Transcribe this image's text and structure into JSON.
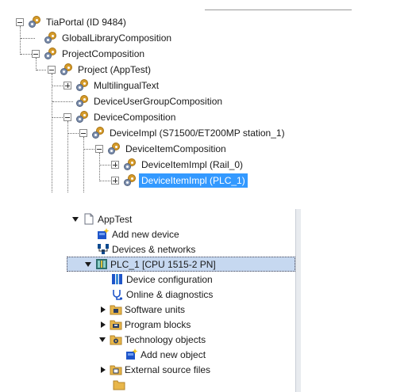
{
  "object_tree": {
    "nodes": [
      {
        "label": "TiaPortal (ID 9484)",
        "expander": "minus"
      },
      {
        "label": "GlobalLibraryComposition",
        "expander": "none"
      },
      {
        "label": "ProjectComposition",
        "expander": "minus"
      },
      {
        "label": "Project (AppTest)",
        "expander": "minus"
      },
      {
        "label": "MultilingualText",
        "expander": "plus"
      },
      {
        "label": "DeviceUserGroupComposition",
        "expander": "none"
      },
      {
        "label": "DeviceComposition",
        "expander": "minus"
      },
      {
        "label": "DeviceImpl (S71500/ET200MP station_1)",
        "expander": "minus"
      },
      {
        "label": "DeviceItemComposition",
        "expander": "minus"
      },
      {
        "label": "DeviceItemImpl (Rail_0)",
        "expander": "plus"
      },
      {
        "label": "DeviceItemImpl (PLC_1)",
        "expander": "plus",
        "selected": true
      }
    ]
  },
  "project_tree": {
    "rows": [
      {
        "label": "AppTest",
        "icon": "project-file-icon",
        "arrow": "down"
      },
      {
        "label": "Add new device",
        "icon": "add-device-icon",
        "arrow": "none"
      },
      {
        "label": "Devices & networks",
        "icon": "network-icon",
        "arrow": "none"
      },
      {
        "label": "PLC_1 [CPU 1515-2 PN]",
        "icon": "plc-icon",
        "arrow": "down",
        "selected": true
      },
      {
        "label": "Device configuration",
        "icon": "device-config-icon",
        "arrow": "none"
      },
      {
        "label": "Online & diagnostics",
        "icon": "diagnostics-icon",
        "arrow": "none"
      },
      {
        "label": "Software units",
        "icon": "folder-units-icon",
        "arrow": "right"
      },
      {
        "label": "Program blocks",
        "icon": "folder-blocks-icon",
        "arrow": "right"
      },
      {
        "label": "Technology objects",
        "icon": "folder-tech-icon",
        "arrow": "down"
      },
      {
        "label": "Add new object",
        "icon": "add-object-icon",
        "arrow": "none"
      },
      {
        "label": "External source files",
        "icon": "folder-source-icon",
        "arrow": "right"
      }
    ]
  },
  "colors": {
    "selection_blue": "#3399ff",
    "row_selection": "#c6d8f0",
    "folder": "#e8b64a"
  }
}
